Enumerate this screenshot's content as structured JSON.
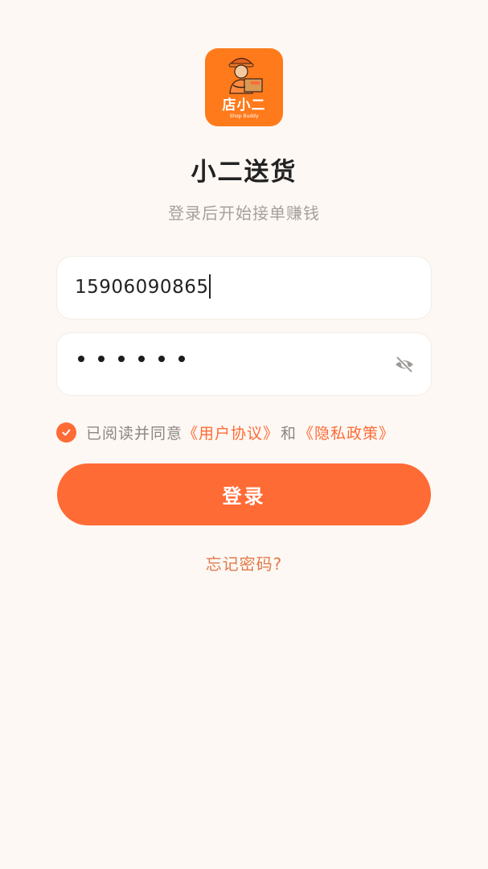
{
  "logo": {
    "icon": "delivery-man-icon",
    "text": "店小二",
    "subtext": "Shop Buddy"
  },
  "header": {
    "title": "小二送货",
    "subtitle": "登录后开始接单赚钱"
  },
  "form": {
    "phone_value": "15906090865",
    "password_masked_length": 6,
    "password_toggle_icon": "eye-off-icon"
  },
  "agreement": {
    "checked": true,
    "prefix": "已阅读并同意",
    "user_agreement": "《用户协议》",
    "and": "和",
    "privacy_policy": "《隐私政策》"
  },
  "actions": {
    "login_label": "登录",
    "forgot_label": "忘记密码?"
  },
  "colors": {
    "accent": "#FF6B35",
    "background": "#FDF8F4",
    "logo_bg": "#FF7A1A"
  }
}
